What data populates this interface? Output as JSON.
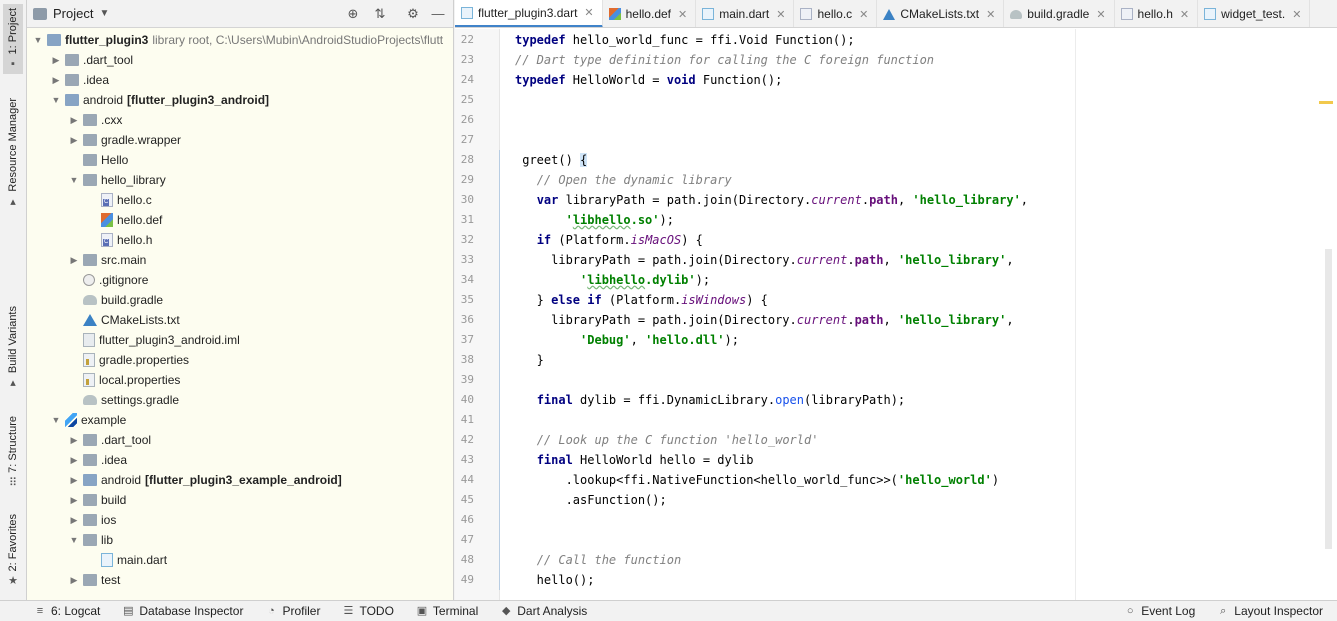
{
  "left_tool_tabs": [
    "1: Project",
    "Resource Manager",
    "Build Variants",
    "7: Structure",
    "2: Favorites"
  ],
  "project_panel": {
    "title": "Project",
    "tree": [
      {
        "depth": 0,
        "arrow": "open",
        "icon": "folder-module",
        "name": "flutter_plugin3",
        "extra": "library root,  C:\\Users\\Mubin\\AndroidStudioProjects\\flutt",
        "bold": true
      },
      {
        "depth": 1,
        "arrow": "closed",
        "icon": "folder",
        "name": ".dart_tool"
      },
      {
        "depth": 1,
        "arrow": "closed",
        "icon": "folder",
        "name": ".idea"
      },
      {
        "depth": 1,
        "arrow": "open",
        "icon": "folder-module",
        "name": "android",
        "extra": "[flutter_plugin3_android]",
        "extra_bold": true
      },
      {
        "depth": 2,
        "arrow": "closed",
        "icon": "folder",
        "name": ".cxx"
      },
      {
        "depth": 2,
        "arrow": "closed",
        "icon": "folder",
        "name": "gradle.wrapper"
      },
      {
        "depth": 2,
        "arrow": "none",
        "icon": "folder",
        "name": "Hello"
      },
      {
        "depth": 2,
        "arrow": "open",
        "icon": "folder",
        "name": "hello_library"
      },
      {
        "depth": 3,
        "arrow": "none",
        "icon": "file-c",
        "name": "hello.c"
      },
      {
        "depth": 3,
        "arrow": "none",
        "icon": "file-def",
        "name": "hello.def"
      },
      {
        "depth": 3,
        "arrow": "none",
        "icon": "file-h",
        "name": "hello.h"
      },
      {
        "depth": 2,
        "arrow": "closed",
        "icon": "folder",
        "name": "src.main"
      },
      {
        "depth": 2,
        "arrow": "none",
        "icon": "file-git",
        "name": ".gitignore"
      },
      {
        "depth": 2,
        "arrow": "none",
        "icon": "file-grad",
        "name": "build.gradle"
      },
      {
        "depth": 2,
        "arrow": "none",
        "icon": "file-cmake",
        "name": "CMakeLists.txt"
      },
      {
        "depth": 2,
        "arrow": "none",
        "icon": "file-iml",
        "name": "flutter_plugin3_android.iml"
      },
      {
        "depth": 2,
        "arrow": "none",
        "icon": "file-prop",
        "name": "gradle.properties"
      },
      {
        "depth": 2,
        "arrow": "none",
        "icon": "file-prop",
        "name": "local.properties"
      },
      {
        "depth": 2,
        "arrow": "none",
        "icon": "file-grad",
        "name": "settings.gradle"
      },
      {
        "depth": 1,
        "arrow": "open",
        "icon": "flutter",
        "name": "example"
      },
      {
        "depth": 2,
        "arrow": "closed",
        "icon": "folder",
        "name": ".dart_tool"
      },
      {
        "depth": 2,
        "arrow": "closed",
        "icon": "folder",
        "name": ".idea"
      },
      {
        "depth": 2,
        "arrow": "closed",
        "icon": "folder-module",
        "name": "android",
        "extra": "[flutter_plugin3_example_android]",
        "extra_bold": true
      },
      {
        "depth": 2,
        "arrow": "closed",
        "icon": "folder",
        "name": "build"
      },
      {
        "depth": 2,
        "arrow": "closed",
        "icon": "folder",
        "name": "ios"
      },
      {
        "depth": 2,
        "arrow": "open",
        "icon": "folder",
        "name": "lib"
      },
      {
        "depth": 3,
        "arrow": "none",
        "icon": "file-dart",
        "name": "main.dart"
      },
      {
        "depth": 2,
        "arrow": "closed",
        "icon": "folder",
        "name": "test"
      }
    ]
  },
  "editor_tabs": [
    {
      "label": "flutter_plugin3.dart",
      "icon": "dart",
      "active": true
    },
    {
      "label": "hello.def",
      "icon": "def"
    },
    {
      "label": "main.dart",
      "icon": "dart"
    },
    {
      "label": "hello.c",
      "icon": "c"
    },
    {
      "label": "CMakeLists.txt",
      "icon": "cmake"
    },
    {
      "label": "build.gradle",
      "icon": "grad"
    },
    {
      "label": "hello.h",
      "icon": "c"
    },
    {
      "label": "widget_test.",
      "icon": "dart"
    }
  ],
  "code_lines": [
    {
      "n": "22",
      "html": "<span class=\"kw\">typedef</span> hello_world_func = ffi.Void Function();"
    },
    {
      "n": "23",
      "html": "<span class=\"cm\">// Dart type definition for calling the C foreign function</span>"
    },
    {
      "n": "24",
      "html": "<span class=\"kw\">typedef</span> HelloWorld = <span class=\"kw\">void</span> Function();"
    },
    {
      "n": "25",
      "html": ""
    },
    {
      "n": "26",
      "html": ""
    },
    {
      "n": "27",
      "html": ""
    },
    {
      "n": "28",
      "html": " greet() <span class=\"brace\">{</span>"
    },
    {
      "n": "29",
      "html": "   <span class=\"cm\">// Open the dynamic library</span>"
    },
    {
      "n": "30",
      "html": "   <span class=\"kw\">var</span> libraryPath = path.join(Directory.<span class=\"it\">current</span>.<span class=\"it\" style=\"font-style:normal;font-weight:bold\">path</span>, <span class=\"st\">'hello_library'</span>,"
    },
    {
      "n": "31",
      "html": "       <span class=\"st\">'<span class=\"tw\">libhello</span>.so'</span>);"
    },
    {
      "n": "32",
      "html": "   <span class=\"kw\">if</span> (Platform.<span class=\"it\">isMacOS</span>) {"
    },
    {
      "n": "33",
      "html": "     libraryPath = path.join(Directory.<span class=\"it\">current</span>.<span class=\"it\" style=\"font-style:normal;font-weight:bold\">path</span>, <span class=\"st\">'hello_library'</span>,"
    },
    {
      "n": "34",
      "html": "         <span class=\"st\">'<span class=\"tw\">libhello</span>.dylib'</span>);"
    },
    {
      "n": "35",
      "html": "   } <span class=\"kw\">else if</span> (Platform.<span class=\"it\">isWindows</span>) {"
    },
    {
      "n": "36",
      "html": "     libraryPath = path.join(Directory.<span class=\"it\">current</span>.<span class=\"it\" style=\"font-style:normal;font-weight:bold\">path</span>, <span class=\"st\">'hello_library'</span>,"
    },
    {
      "n": "37",
      "html": "         <span class=\"st\">'Debug'</span>, <span class=\"st\">'hello.dll'</span>);"
    },
    {
      "n": "38",
      "html": "   }"
    },
    {
      "n": "39",
      "html": ""
    },
    {
      "n": "40",
      "html": "   <span class=\"kw\">final</span> dylib = ffi.DynamicLibrary.<span class=\"fn\">open</span>(libraryPath);"
    },
    {
      "n": "41",
      "html": ""
    },
    {
      "n": "42",
      "html": "   <span class=\"cm\">// Look up the C function 'hello_world'</span>"
    },
    {
      "n": "43",
      "html": "   <span class=\"kw\">final</span> HelloWorld hello = dylib"
    },
    {
      "n": "44",
      "html": "       .lookup&lt;ffi.NativeFunction&lt;hello_world_func&gt;&gt;(<span class=\"st\">'hello_world'</span>)"
    },
    {
      "n": "45",
      "html": "       .asFunction();"
    },
    {
      "n": "46",
      "html": ""
    },
    {
      "n": "47",
      "html": ""
    },
    {
      "n": "48",
      "html": "   <span class=\"cm\">// Call the function</span>"
    },
    {
      "n": "49",
      "html": "   hello();"
    }
  ],
  "bottom_left": [
    {
      "label": "6: Logcat",
      "icon": "≡"
    },
    {
      "label": "Database Inspector",
      "icon": "▤"
    },
    {
      "label": "Profiler",
      "icon": "◔"
    },
    {
      "label": "TODO",
      "icon": "☰"
    },
    {
      "label": "Terminal",
      "icon": "▣"
    },
    {
      "label": "Dart Analysis",
      "icon": "◆"
    }
  ],
  "bottom_right": [
    {
      "label": "Event Log",
      "icon": "○"
    },
    {
      "label": "Layout Inspector",
      "icon": "⌕"
    }
  ]
}
